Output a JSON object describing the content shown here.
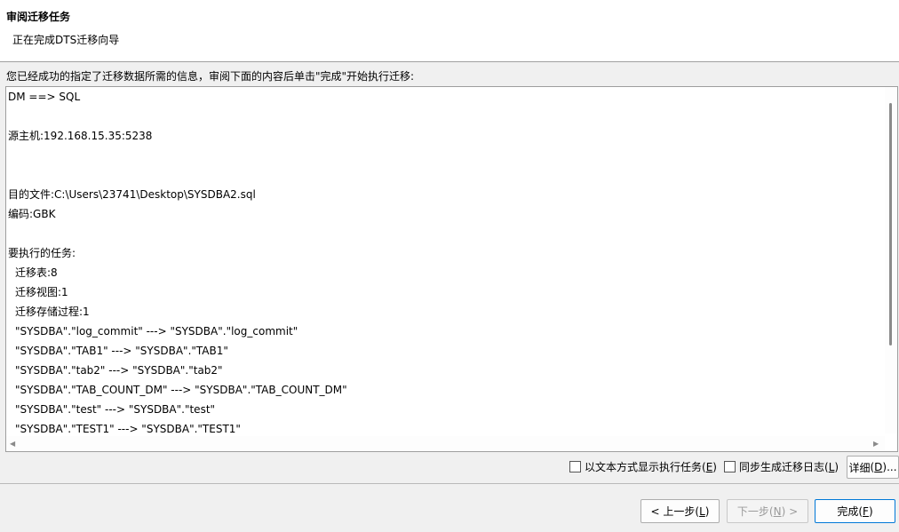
{
  "header": {
    "title": "审阅迁移任务",
    "subtitle": "正在完成DTS迁移向导"
  },
  "instruction": "您已经成功的指定了迁移数据所需的信息，审阅下面的内容后单击\"完成\"开始执行迁移:",
  "summary_lines": [
    {
      "text": "DM ==> SQL",
      "indent": false
    },
    {
      "text": "",
      "indent": false
    },
    {
      "text": "源主机:192.168.15.35:5238",
      "indent": false
    },
    {
      "text": "",
      "indent": false
    },
    {
      "text": "",
      "indent": false
    },
    {
      "text": "目的文件:C:\\Users\\23741\\Desktop\\SYSDBA2.sql",
      "indent": false
    },
    {
      "text": "编码:GBK",
      "indent": false
    },
    {
      "text": "",
      "indent": false
    },
    {
      "text": "要执行的任务:",
      "indent": false
    },
    {
      "text": "迁移表:8",
      "indent": true
    },
    {
      "text": "迁移视图:1",
      "indent": true
    },
    {
      "text": "迁移存储过程:1",
      "indent": true
    },
    {
      "text": "\"SYSDBA\".\"log_commit\" ---> \"SYSDBA\".\"log_commit\"",
      "indent": true
    },
    {
      "text": "\"SYSDBA\".\"TAB1\" ---> \"SYSDBA\".\"TAB1\"",
      "indent": true
    },
    {
      "text": "\"SYSDBA\".\"tab2\" ---> \"SYSDBA\".\"tab2\"",
      "indent": true
    },
    {
      "text": "\"SYSDBA\".\"TAB_COUNT_DM\" ---> \"SYSDBA\".\"TAB_COUNT_DM\"",
      "indent": true
    },
    {
      "text": "\"SYSDBA\".\"test\" ---> \"SYSDBA\".\"test\"",
      "indent": true
    },
    {
      "text": "\"SYSDBA\".\"TEST1\" ---> \"SYSDBA\".\"TEST1\"",
      "indent": true
    }
  ],
  "options": {
    "show_as_text": {
      "label": "以文本方式显示执行任务",
      "key": "E",
      "checked": false
    },
    "sync_log": {
      "label": "同步生成迁移日志",
      "key": "L",
      "checked": false
    }
  },
  "detail_button": {
    "label": "详细",
    "key": "D",
    "suffix": "..."
  },
  "nav": {
    "prev": {
      "prefix": "< ",
      "label": "上一步",
      "key": "L",
      "suffix": ""
    },
    "next": {
      "prefix": "",
      "label": "下一步",
      "key": "N",
      "suffix": " >"
    },
    "finish": {
      "prefix": "",
      "label": "完成",
      "key": "F",
      "suffix": ""
    }
  },
  "icons": {
    "scroll_left": "triangle-left-icon",
    "scroll_right": "triangle-right-icon"
  }
}
